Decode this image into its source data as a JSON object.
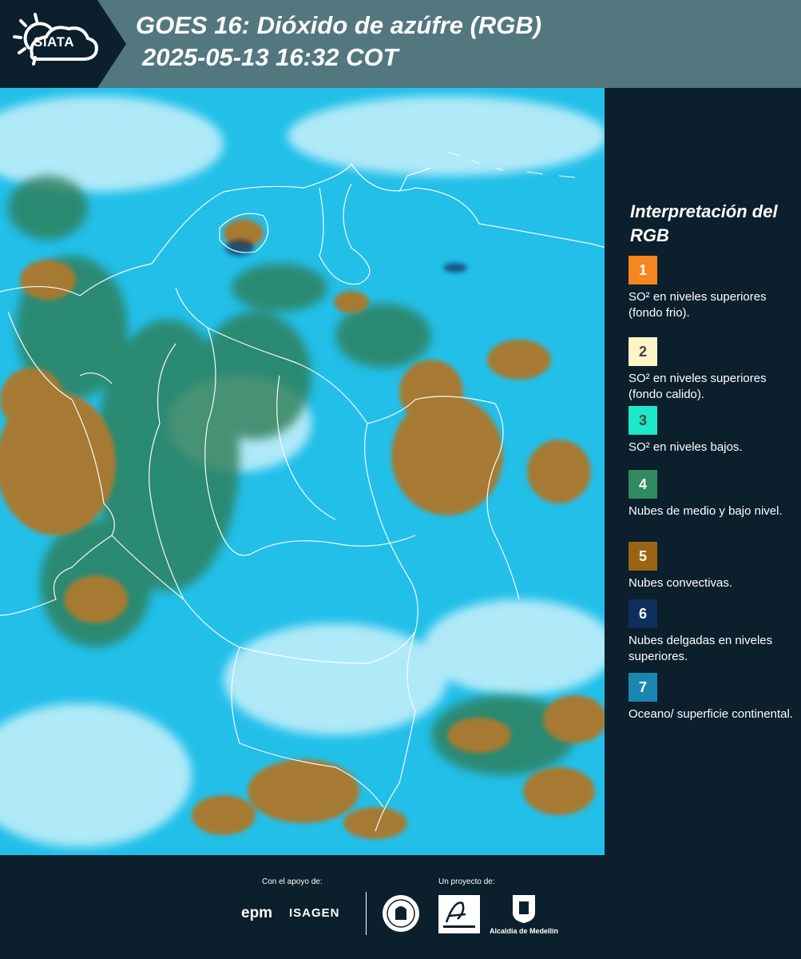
{
  "header": {
    "logo_text": "SIATA",
    "title_line1": "GOES 16: Dióxido de azúfre (RGB)",
    "title_line2": "2025-05-13 16:32 COT"
  },
  "map": {
    "icon": "satellite-rgb-map",
    "colors": {
      "ocean_surface": "#1dbde8",
      "cloud_green": "#2e7a52",
      "convective": "#a87a32",
      "high_thin": "#c8f0fb"
    }
  },
  "legend": {
    "title": "Interpretación del RGB",
    "items": [
      {
        "number": "1",
        "label": "SO² en niveles superiores (fondo frio).",
        "color": "#f7861e",
        "text_color": "#ffffff"
      },
      {
        "number": "2",
        "label": "SO² en niveles superiores (fondo calido).",
        "color": "#fdf5c5",
        "text_color": "#444444"
      },
      {
        "number": "3",
        "label": "SO² en niveles bajos.",
        "color": "#1de8c8",
        "text_color": "#444444"
      },
      {
        "number": "4",
        "label": "Nubes de medio y bajo nivel.",
        "color": "#2f8a60",
        "text_color": "#ffffff"
      },
      {
        "number": "5",
        "label": "Nubes convectivas.",
        "color": "#9a6512",
        "text_color": "#ffffff"
      },
      {
        "number": "6",
        "label": "Nubes delgadas en niveles superiores.",
        "color": "#0e2f5c",
        "text_color": "#ffffff"
      },
      {
        "number": "7",
        "label": "Oceano/ superficie continental.",
        "color": "#1b87b0",
        "text_color": "#ffffff"
      }
    ]
  },
  "footer": {
    "support_label": "Con el apoyo de:",
    "project_label": "Un proyecto de:",
    "sponsor_epm": "epm",
    "sponsor_isagen": "ISAGEN",
    "alcaldia": "Alcaldía de Medellín"
  }
}
